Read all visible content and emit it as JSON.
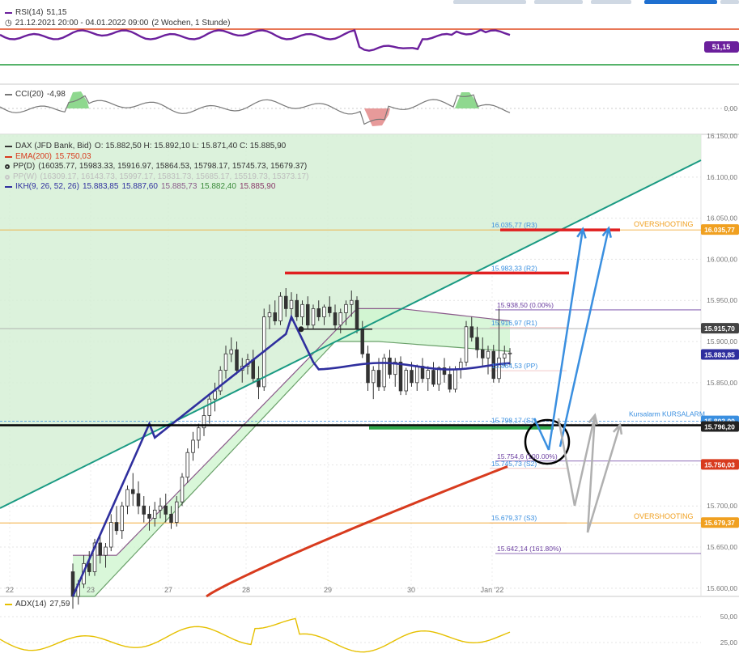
{
  "colors": {
    "rsi_line": "#6b1f9c",
    "rsi_upper": "#e04a1f",
    "rsi_lower": "#1f9a38",
    "cci_line": "#777777",
    "cci_pos_fill": "#8fd88f",
    "cci_neg_fill": "#e79a9a",
    "green_zone": "#d6f0d6",
    "trend_line": "#1a9a83",
    "ema": "#d83b1e",
    "kijun": "#2f2f9e",
    "cloud_line": "#8a5a8a",
    "cloud_fill": "#cff5cf",
    "cloud_lower": "#6aa06a",
    "candle": "#333333",
    "blue_arrow": "#3a8fe0",
    "gray_arrow": "#b0b0b0",
    "red_line": "#e02020",
    "black_line": "#000000",
    "green_line": "#2ea84a",
    "overshoot": "#f0a020",
    "adx": "#e6c000",
    "r_label": "#3a8fe0"
  },
  "rsi_panel": {
    "title": "RSI(14)",
    "value": "51,15",
    "period": "21.12.2021 20:00 - 04.01.2022 09:00",
    "interval": "(2 Wochen, 1 Stunde)",
    "badge": "51,15"
  },
  "cci_panel": {
    "title": "CCI(20)",
    "value": "-4,98",
    "zero_label": "0,00"
  },
  "main_legend": {
    "instrument": "DAX (JFD Bank, Bid)",
    "ohlc": "O: 15.882,50  H: 15.892,10  L: 15.871,40  C: 15.885,90",
    "ema": "EMA(200)",
    "ema_value": "15.750,03",
    "pp_d": "PP(D)",
    "pp_d_values": "(16035.77, 15983.33, 15916.97, 15864.53, 15798.17, 15745.73, 15679.37)",
    "pp_w": "PP(W)",
    "pp_w_values": "(16309.17, 16143.73, 15997.17, 15831.73, 15685.17, 15519.73, 15373.17)",
    "ikh": "IKH(9, 26, 52, 26)",
    "ikh_values": [
      "15.883,85",
      "15.887,60",
      "15.885,73",
      "15.882,40",
      "15.885,90"
    ]
  },
  "adx_panel": {
    "title": "ADX(14)",
    "value": "27,59",
    "ticks": [
      "50,00",
      "25,00"
    ]
  },
  "chart_data": {
    "type": "candlestick",
    "title": "DAX (JFD Bank, Bid)",
    "interval": "1 Stunde",
    "x_tick_labels": [
      "22",
      "23",
      "27",
      "28",
      "29",
      "30",
      "Jan '22"
    ],
    "y_tick_labels": [
      "16.150,00",
      "16.100,00",
      "16.050,00",
      "16.000,00",
      "15.950,00",
      "15.900,00",
      "15.850,00",
      "15.800,00",
      "15.750,00",
      "15.700,00",
      "15.650,00",
      "15.600,00"
    ],
    "ylim": [
      15590,
      16152
    ],
    "grid": true,
    "pivot_levels": [
      {
        "label": "16.035,77 (R3)",
        "value": 16035.77
      },
      {
        "label": "15.983,33 (R2)",
        "value": 15983.33
      },
      {
        "label": "15.916,97 (R1)",
        "value": 15916.97
      },
      {
        "label": "15.864,53 (PP)",
        "value": 15864.53
      },
      {
        "label": "15.798,17 (S1)",
        "value": 15798.17
      },
      {
        "label": "15.745,73 (S2)",
        "value": 15745.73
      },
      {
        "label": "15.679,37 (S3)",
        "value": 15679.37
      }
    ],
    "fibonacci": [
      {
        "label": "15.938,50 (0.00%)",
        "value": 15938.5
      },
      {
        "label": "15.754,6 (100.00%)",
        "value": 15754.6
      },
      {
        "label": "15.642,14 (161.80%)",
        "value": 15642.14
      }
    ],
    "annotations": [
      "OVERSHOOTING",
      "OVERSHOOTING",
      "Kursalarm",
      "KURSALARM"
    ],
    "price_badges": [
      {
        "text": "16.035,77",
        "value": 16035.77
      },
      {
        "text": "15.915,70",
        "value": 15915.7
      },
      {
        "text": "15.883,85",
        "value": 15883.85
      },
      {
        "text": "15.803,00",
        "value": 15803.0
      },
      {
        "text": "15.796,20",
        "value": 15796.2
      },
      {
        "text": "15.750,03",
        "value": 15750.03
      },
      {
        "text": "15.679,37",
        "value": 15679.37
      }
    ],
    "candles": [
      [
        15620,
        15630,
        15575,
        15590
      ],
      [
        15590,
        15610,
        15580,
        15605
      ],
      [
        15605,
        15640,
        15600,
        15630
      ],
      [
        15630,
        15645,
        15615,
        15620
      ],
      [
        15620,
        15660,
        15615,
        15655
      ],
      [
        15655,
        15665,
        15630,
        15640
      ],
      [
        15640,
        15655,
        15625,
        15650
      ],
      [
        15650,
        15690,
        15645,
        15680
      ],
      [
        15680,
        15700,
        15665,
        15670
      ],
      [
        15670,
        15705,
        15660,
        15700
      ],
      [
        15700,
        15725,
        15690,
        15720
      ],
      [
        15720,
        15740,
        15700,
        15715
      ],
      [
        15715,
        15730,
        15690,
        15700
      ],
      [
        15700,
        15712,
        15680,
        15690
      ],
      [
        15690,
        15700,
        15670,
        15685
      ],
      [
        15685,
        15705,
        15675,
        15695
      ],
      [
        15695,
        15710,
        15685,
        15700
      ],
      [
        15700,
        15715,
        15680,
        15690
      ],
      [
        15690,
        15700,
        15672,
        15680
      ],
      [
        15680,
        15712,
        15675,
        15705
      ],
      [
        15705,
        15740,
        15700,
        15735
      ],
      [
        15735,
        15770,
        15728,
        15765
      ],
      [
        15765,
        15790,
        15755,
        15780
      ],
      [
        15780,
        15800,
        15770,
        15795
      ],
      [
        15795,
        15820,
        15785,
        15810
      ],
      [
        15810,
        15835,
        15800,
        15830
      ],
      [
        15830,
        15850,
        15815,
        15840
      ],
      [
        15840,
        15870,
        15835,
        15865
      ],
      [
        15865,
        15895,
        15855,
        15885
      ],
      [
        15885,
        15905,
        15875,
        15890
      ],
      [
        15890,
        15900,
        15860,
        15865
      ],
      [
        15865,
        15880,
        15850,
        15870
      ],
      [
        15870,
        15885,
        15860,
        15878
      ],
      [
        15878,
        15890,
        15850,
        15855
      ],
      [
        15855,
        15870,
        15830,
        15845
      ],
      [
        15845,
        15940,
        15840,
        15930
      ],
      [
        15930,
        15945,
        15915,
        15935
      ],
      [
        15935,
        15950,
        15920,
        15925
      ],
      [
        15925,
        15960,
        15920,
        15955
      ],
      [
        15955,
        15965,
        15930,
        15940
      ],
      [
        15940,
        15960,
        15925,
        15950
      ],
      [
        15950,
        15958,
        15925,
        15930
      ],
      [
        15930,
        15950,
        15920,
        15945
      ],
      [
        15945,
        15955,
        15915,
        15920
      ],
      [
        15920,
        15945,
        15915,
        15940
      ],
      [
        15940,
        15950,
        15925,
        15930
      ],
      [
        15930,
        15945,
        15920,
        15942
      ],
      [
        15942,
        15955,
        15930,
        15935
      ],
      [
        15935,
        15945,
        15915,
        15920
      ],
      [
        15920,
        15940,
        15910,
        15935
      ],
      [
        15935,
        15950,
        15920,
        15945
      ],
      [
        15945,
        15962,
        15930,
        15950
      ],
      [
        15950,
        15955,
        15910,
        15915
      ],
      [
        15915,
        15925,
        15880,
        15885
      ],
      [
        15885,
        15895,
        15840,
        15850
      ],
      [
        15850,
        15870,
        15830,
        15865
      ],
      [
        15865,
        15880,
        15840,
        15845
      ],
      [
        15845,
        15885,
        15840,
        15880
      ],
      [
        15880,
        15890,
        15855,
        15860
      ],
      [
        15860,
        15880,
        15845,
        15875
      ],
      [
        15875,
        15882,
        15835,
        15840
      ],
      [
        15840,
        15868,
        15835,
        15865
      ],
      [
        15865,
        15875,
        15845,
        15850
      ],
      [
        15850,
        15872,
        15840,
        15870
      ],
      [
        15870,
        15880,
        15850,
        15855
      ],
      [
        15855,
        15870,
        15840,
        15865
      ],
      [
        15865,
        15875,
        15845,
        15848
      ],
      [
        15848,
        15870,
        15840,
        15868
      ],
      [
        15868,
        15880,
        15850,
        15860
      ],
      [
        15860,
        15870,
        15838,
        15842
      ],
      [
        15842,
        15870,
        15838,
        15866
      ],
      [
        15866,
        15880,
        15855,
        15875
      ],
      [
        15875,
        15925,
        15870,
        15918
      ],
      [
        15918,
        15930,
        15900,
        15905
      ],
      [
        15905,
        15918,
        15880,
        15890
      ],
      [
        15890,
        15905,
        15870,
        15880
      ],
      [
        15880,
        15895,
        15860,
        15888
      ],
      [
        15888,
        15896,
        15850,
        15855
      ],
      [
        15855,
        15940,
        15850,
        15880
      ],
      [
        15880,
        15895,
        15870,
        15885
      ],
      [
        15885,
        15892,
        15871,
        15886
      ]
    ]
  }
}
